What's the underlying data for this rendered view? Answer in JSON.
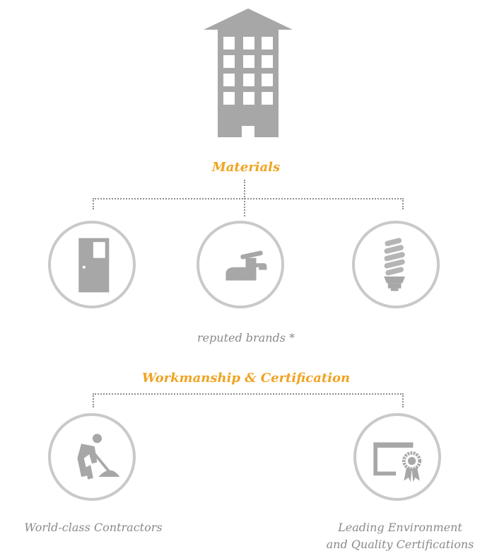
{
  "materials": {
    "heading": "Materials",
    "caption": "reputed brands *",
    "icons": [
      "door-icon",
      "faucet-icon",
      "light-bulb-icon"
    ]
  },
  "workmanship": {
    "heading": "Workmanship & Certification",
    "items": [
      {
        "label": "World-class Contractors",
        "icon": "worker-icon"
      },
      {
        "label_line1": "Leading Environment",
        "label_line2": "and Quality Certifications",
        "icon": "certificate-icon"
      }
    ]
  },
  "colors": {
    "accent": "#f0a321",
    "icon_gray": "#a7a7a7",
    "circle_gray": "#c9c9c9",
    "caption_gray": "#8a8a8a"
  }
}
